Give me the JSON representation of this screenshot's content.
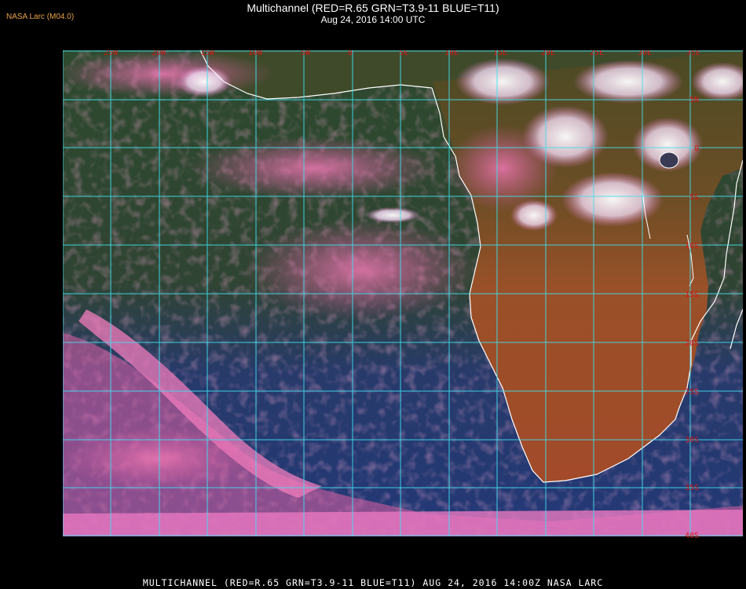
{
  "header": {
    "credit": "NASA Larc (M04.0)",
    "title": "Multichannel (RED=R.65 GRN=T3.9-11 BLUE=T11)",
    "subtitle": "Aug 24, 2016 14:00 UTC"
  },
  "footer": {
    "caption": "MULTICHANNEL (RED=R.65 GRN=T3.9-11 BLUE=T11) AUG 24, 2016 14:00Z  NASA LARC"
  },
  "map": {
    "longitude_labels": [
      "25W",
      "20W",
      "15W",
      "10W",
      "5W",
      "0",
      "5E",
      "10E",
      "15E",
      "20E",
      "25E",
      "30E",
      "35E"
    ],
    "latitude_labels": [
      "5N",
      "0",
      "5S",
      "10S",
      "15S",
      "20S",
      "25S",
      "30S",
      "35S",
      "40S"
    ],
    "colors": {
      "grid": "#40e0f0",
      "coastline": "#ffffff",
      "label": "#d81818",
      "ocean": "#27406f",
      "land": "#a0502a",
      "tropical_land": "#4e4a26",
      "cloud_pink": "#e46aa6",
      "cloud_white": "#f4e8f4"
    }
  }
}
